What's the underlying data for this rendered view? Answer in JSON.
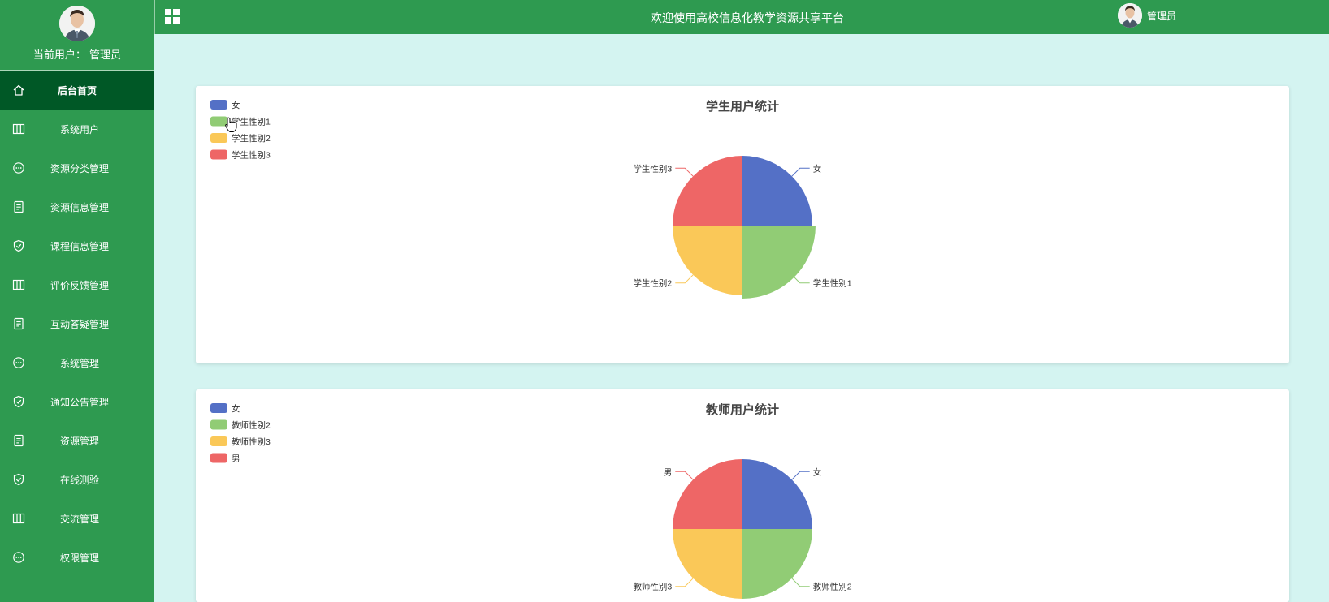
{
  "sidebar": {
    "current_user": "当前用户：  管理员",
    "items": [
      {
        "label": "后台首页",
        "icon": "home-icon",
        "active": true
      },
      {
        "label": "系统用户",
        "icon": "columns-icon"
      },
      {
        "label": "资源分类管理",
        "icon": "chat-icon"
      },
      {
        "label": "资源信息管理",
        "icon": "document-icon"
      },
      {
        "label": "课程信息管理",
        "icon": "shield-check-icon"
      },
      {
        "label": "评价反馈管理",
        "icon": "columns-icon"
      },
      {
        "label": "互动答疑管理",
        "icon": "document-icon"
      },
      {
        "label": "系统管理",
        "icon": "chat-icon"
      },
      {
        "label": "通知公告管理",
        "icon": "shield-check-icon"
      },
      {
        "label": "资源管理",
        "icon": "document-icon"
      },
      {
        "label": "在线测验",
        "icon": "shield-check-icon"
      },
      {
        "label": "交流管理",
        "icon": "columns-icon"
      },
      {
        "label": "权限管理",
        "icon": "chat-icon"
      }
    ]
  },
  "header": {
    "title": "欢迎使用高校信息化教学资源共享平台",
    "user_name": "管理员"
  },
  "colors": {
    "sidebar_bg": "#2e9a50",
    "sidebar_active": "#005826",
    "content_bg": "#d4f4f1",
    "series": [
      "#5470c6",
      "#91cc75",
      "#fac858",
      "#ee6666"
    ]
  },
  "chart_data": [
    {
      "type": "pie",
      "title": "学生用户统计",
      "legend_position": "top-left",
      "categories": [
        "女",
        "学生性别1",
        "学生性别2",
        "学生性别3"
      ],
      "values": [
        1,
        1,
        1,
        1
      ],
      "highlighted": "学生性别1"
    },
    {
      "type": "pie",
      "title": "教师用户统计",
      "legend_position": "top-left",
      "categories": [
        "女",
        "教师性别2",
        "教师性别3",
        "男"
      ],
      "values": [
        1,
        1,
        1,
        1
      ]
    }
  ]
}
